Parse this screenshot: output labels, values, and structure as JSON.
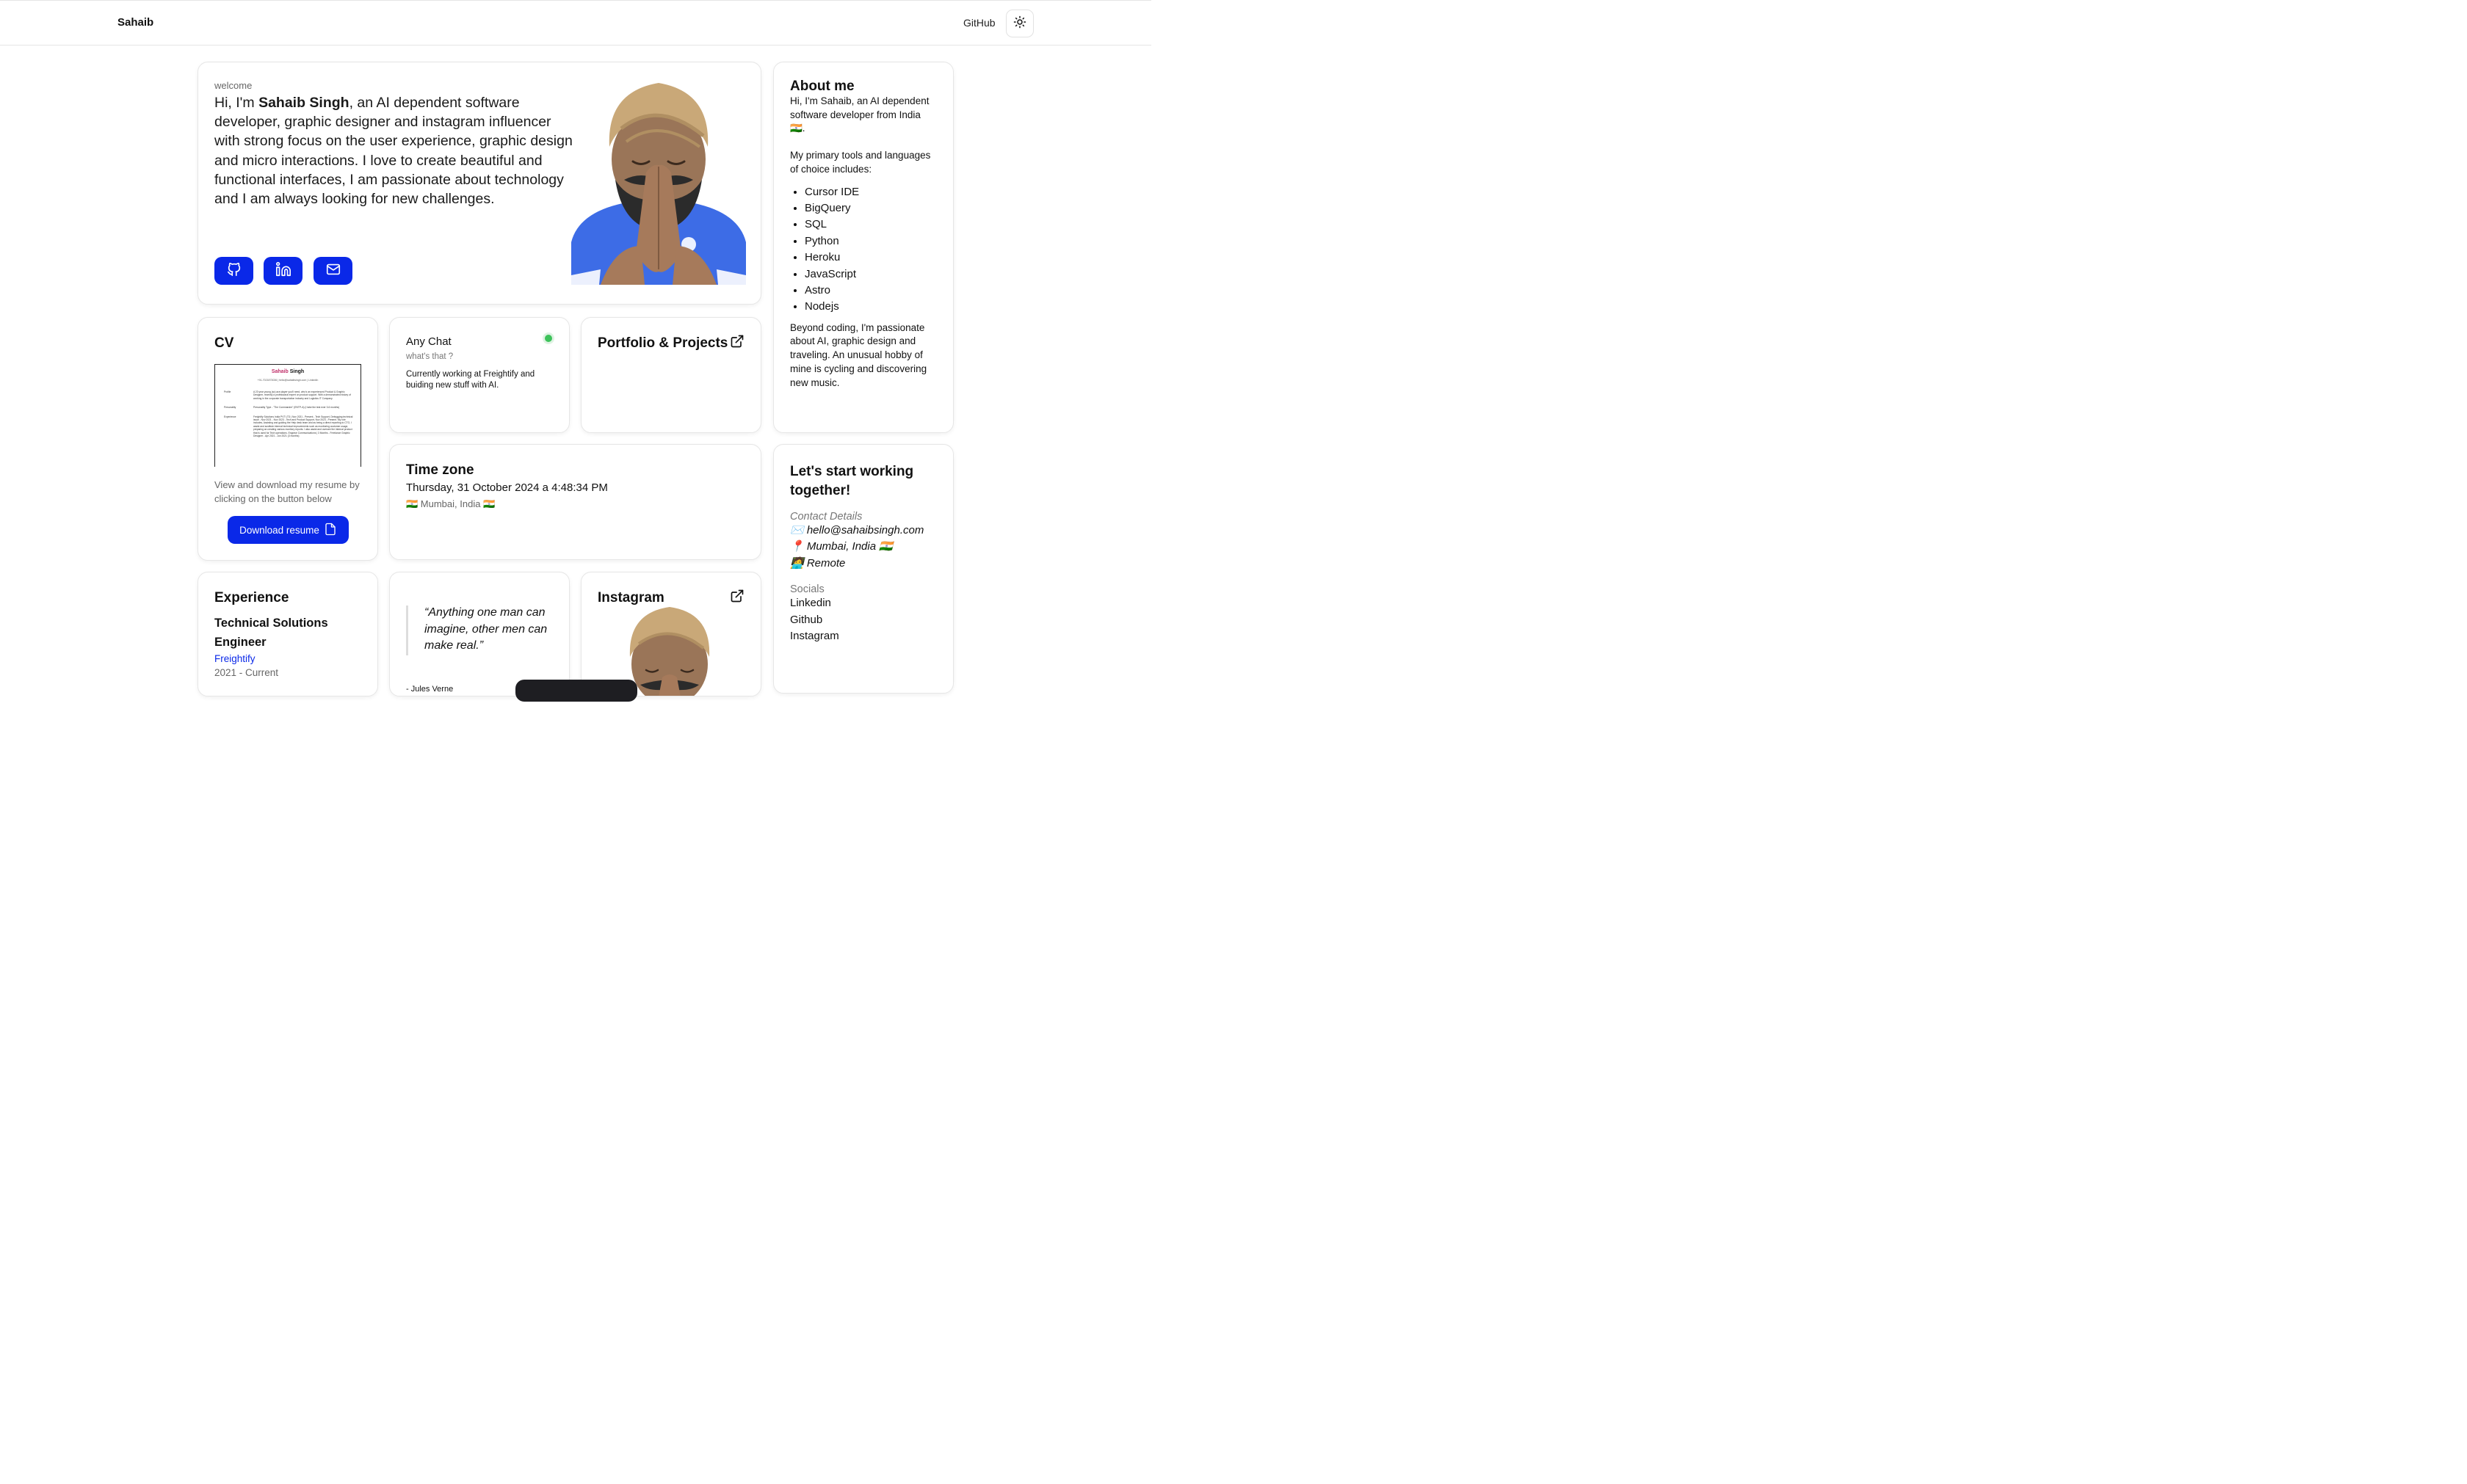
{
  "nav": {
    "brand": "Sahaib",
    "github": "GitHub",
    "theme_icon": "sun-icon"
  },
  "hero": {
    "eyebrow": "welcome",
    "intro_prefix": "Hi, I'm ",
    "name": "Sahaib Singh",
    "intro_rest": ", an AI dependent software developer, graphic designer and instagram influencer with strong focus on the user experience, graphic design and micro interactions. I love to create beautiful and functional interfaces, I am passionate about technology and I am always looking for new challenges.",
    "social_icons": [
      "github-icon",
      "linkedin-icon",
      "mail-icon"
    ],
    "accent": "#0a28e8"
  },
  "about": {
    "title": "About me",
    "intro": "Hi, I'm Sahaib, an AI dependent software developer from India 🇮🇳.",
    "tools_intro": "My primary tools and languages of choice includes:",
    "tools": [
      "Cursor IDE",
      "BigQuery",
      "SQL",
      "Python",
      "Heroku",
      "JavaScript",
      "Astro",
      "Nodejs"
    ],
    "outro": "Beyond coding, I'm passionate about AI, graphic design and traveling. An unusual hobby of mine is cycling and discovering new music."
  },
  "cv": {
    "title": "CV",
    "preview": {
      "name_first": "Sahaib",
      "name_last": " Singh",
      "contact": "+91-7021873036 | hello@sahaibsingh.com | LinkedIn",
      "rows": [
        {
          "label": "Profile",
          "text": "A 23 year young (so) ace player you'll need, who's an experienced Product & Graphic Designer, recently a professional expert on product support. With a demonstrated history of working in the corporate transportation industry and Logistics IT Company."
        },
        {
          "label": "Personality",
          "text": "Personality Type - \"The Commander\" (ENTP-A) (I take the test ever 3-6 months)"
        },
        {
          "label": "Experience",
          "text": "Freightify Solutions India PVT LTD | Nov 2021 - Present - Tech Support, Debugging technical issue - Nov 2021 - Nov 2023 - Tech and Product Support, Nov 2023 - Present. My role includes, Assisting and guiding the Help desk team and as being a direct reporting to CTO, I assist and sustitute internal technical improvements such as monitoring customer usage, preparing an creating various monitory reports. I also assist and oversee the internal product that is used for Tech operations. Engrave Communications | 3 Months - Freelance Graphic Designer - Apr 2021 - Jun 2021 (3 months)"
        }
      ]
    },
    "description": "View and download my resume by clicking on the button below",
    "download_label": "Download resume"
  },
  "chat": {
    "title": "Any Chat",
    "subtitle": "what's that ?",
    "body": "Currently working at Freightify and buiding new stuff with AI.",
    "status_color": "#3dc25a"
  },
  "portfolio": {
    "title": "Portfolio & Projects"
  },
  "timezone": {
    "title": "Time zone",
    "datetime": "Thursday, 31 October 2024 a 4:48:34 PM",
    "location": "🇮🇳 Mumbai, India 🇮🇳"
  },
  "contact": {
    "title": "Let's start working together!",
    "details_label": "Contact Details",
    "email": "✉️ hello@sahaibsingh.com",
    "location": "📍 Mumbai, India 🇮🇳",
    "work": "🧑‍💻 Remote",
    "socials_label": "Socials",
    "socials": [
      "Linkedin",
      "Github",
      "Instagram"
    ]
  },
  "experience": {
    "title": "Experience",
    "role": "Technical Solutions Engineer",
    "company": "Freightify",
    "dates": "2021 - Current"
  },
  "quote": {
    "text": "“Anything one man can imagine, other men can make real.”",
    "author": "- Jules Verne"
  },
  "instagram": {
    "title": "Instagram"
  }
}
